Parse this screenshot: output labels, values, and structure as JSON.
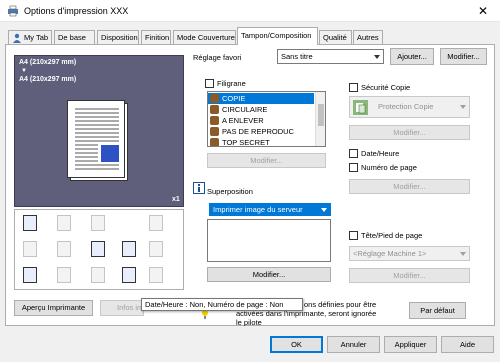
{
  "window": {
    "title": "Options d'impression XXX",
    "close_glyph": "✕"
  },
  "tabs": [
    {
      "label": "My Tab",
      "icon": "user-icon"
    },
    {
      "label": "De base"
    },
    {
      "label": "Disposition"
    },
    {
      "label": "Finition"
    },
    {
      "label": "Mode Couverture"
    },
    {
      "label": "Tampon/Composition",
      "active": true
    },
    {
      "label": "Qualité"
    },
    {
      "label": "Autres"
    }
  ],
  "preview": {
    "paper_line1": "A4 (210x297 mm)",
    "arrow": "▼",
    "paper_line2": "A4 (210x297 mm)",
    "copies": "x1"
  },
  "favorites": {
    "label": "Réglage favori",
    "value": "Sans titre",
    "add_button": "Ajouter...",
    "modify_button": "Modifier..."
  },
  "watermark": {
    "label": "Filigrane",
    "items": [
      "COPIE",
      "CIRCULAIRE",
      "A ENLEVER",
      "PAS DE REPRODUC",
      "TOP SECRET"
    ],
    "modify_button": "Modifier..."
  },
  "overlay": {
    "label": "Superposition",
    "value": "Imprimer image du serveur",
    "modify_button": "Modifier..."
  },
  "copy_security": {
    "label": "Sécurité Copie",
    "value": "Protection Copie",
    "modify_button": "Modifier..."
  },
  "date_time": {
    "label": "Date/Heure"
  },
  "page_number": {
    "label": "Numéro de page",
    "modify_button": "Modifier..."
  },
  "header_footer": {
    "label": "Tête/Pied de page",
    "value": "<Réglage Machine 1>",
    "modify_button": "Modifier..."
  },
  "preview_buttons": {
    "printer_view": "Aperçu Imprimante",
    "info": "Infos im"
  },
  "tooltip": "Date/Heure : Non, Numéro de page : Non",
  "note_lines": [
    "ons définies pour être",
    "activées dans l'imprimante, seront ignorées dans",
    "le pilote"
  ],
  "default_button": "Par défaut",
  "footer": {
    "ok": "OK",
    "cancel": "Annuler",
    "apply": "Appliquer",
    "help": "Aide"
  },
  "colors": {
    "accent": "#0078d7",
    "selected_row": "#0078d7",
    "tooltip_bg": "#ffffff"
  }
}
